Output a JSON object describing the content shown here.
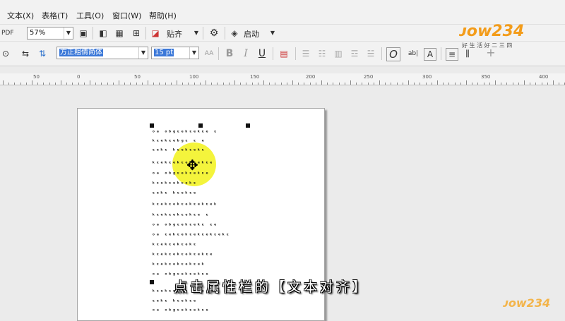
{
  "menubar": {
    "items": [
      "文本(X)",
      "表格(T)",
      "工具(O)",
      "窗口(W)",
      "帮助(H)"
    ]
  },
  "toolbar1": {
    "pdf_label": "PDF",
    "zoom_value": "57%",
    "snap_label": "贴齐",
    "launch_label": "启动"
  },
  "toolbar2": {
    "font_name": "方正粗倩简体",
    "font_size": "15 pt",
    "ab_label": "ab|",
    "plus_label": "+"
  },
  "ruler": {
    "labels": [
      "50",
      "0",
      "50",
      "100",
      "150",
      "200",
      "250",
      "300",
      "350",
      "400"
    ]
  },
  "document": {
    "lines": [
      "ᵒᵃ ᵒᵇᵍᵋᵉᵏᵋᵉᵏᵋᵉ ᵋ",
      "ᵏᵋᵉᵏᵋᵉᵇᵍᵋ ᵋ ᵉ",
      "ᵋᵉᵏᵋ ᵏᵋᵉᵏᵋᵉᵏᵋ",
      "ᵏᵋᵉᵏᵋᵉᵏᵋᵉᵏᵋᵉᵏᵋᵉ",
      "ᵒᵃ ᵒᵇᵍᵋᵉᵏᵋᵉᵏᵋᵉ",
      "ᵏᵋᵉᵏᵋᵉᵏᵋᵉᵏᵋ",
      "ᵋᵉᵏᵋ ᵏᵋᵉᵏᵋᵉ",
      "ᵏᵋᵉᵏᵋᵉᵏᵋᵉᵏᵋᵉᵏᵋᵉᵏ",
      "ᵏᵋᵉᵏᵋᵉᵏᵋᵉᵏᵋᵉ ᵋ",
      "ᵒᵃ ᵒᵇᵍᵋᵉᵏᵋᵉᵏᵋ ᵋᵉ",
      "ᵒᵃ ᵋᵉᵏᵋᵉᵏᵋᵉᵏᵋᵉᵏᵋᵉᵏᵋ",
      "ᵏᵋᵉᵏᵋᵉᵏᵋᵉᵏᵋ",
      "ᵏᵋᵉᵏᵋᵉᵏᵋᵉᵏᵋᵉᵏᵋᵉ",
      "ᵏᵋᵉᵏᵋᵉᵏᵋᵉᵏᵋᵉᵏ",
      "ᵒᵃ ᵒᵇᵍᵋᵉᵏᵋᵉᵏᵋᵉ",
      "ᵏᵋᵉᵏᵋᵉᵇᵍᵋ ᵋ ᵉ",
      "ᵋᵉᵏᵋ ᵏᵋᵉᵏᵋᵉ",
      "ᵒᵃ ᵒᵇᵍᵋᵉᵏᵋᵉᵏᵋᵉ",
      "ᵏᵋᵉᵏᵋᵉᵏᵋᵉᵏ"
    ]
  },
  "subtitle": "点击属性栏的【文本对齐】",
  "watermark": {
    "brand": "ᴊᴏᴡ234",
    "slogan": "好 生 活 好 二 三 四"
  },
  "colors": {
    "highlight": "#f2f21a",
    "selection": "#3b78d8"
  }
}
